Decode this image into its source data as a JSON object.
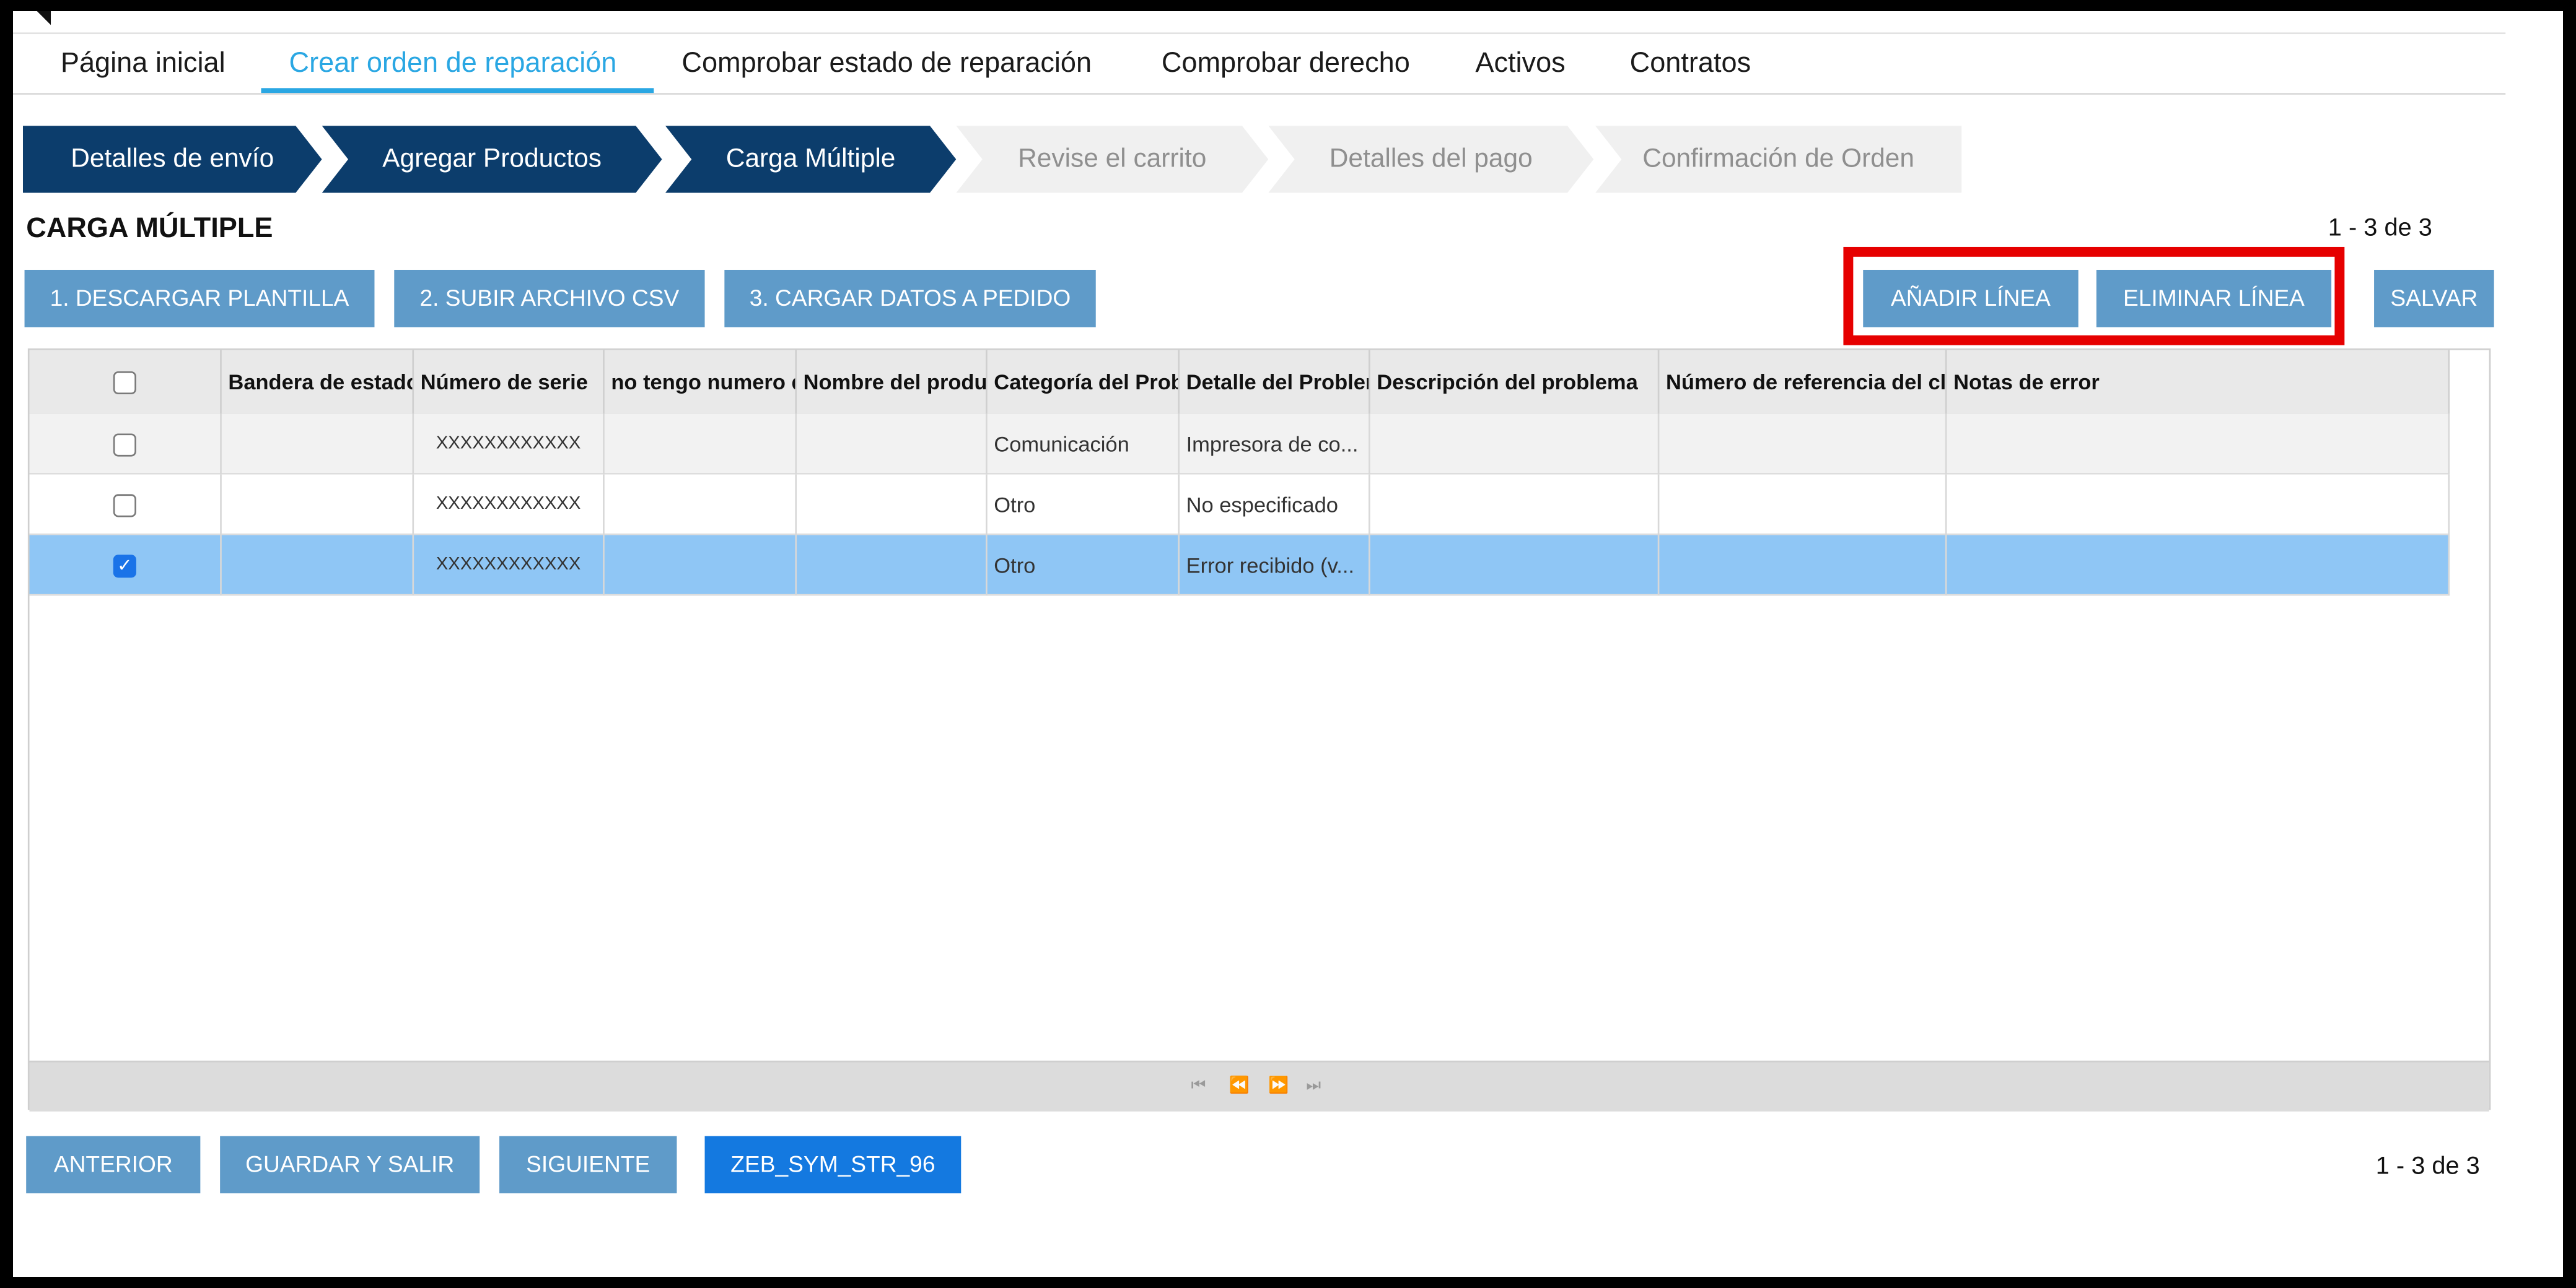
{
  "nav": {
    "items": [
      {
        "label": "Página inicial"
      },
      {
        "label": "Crear orden de reparación"
      },
      {
        "label": "Comprobar estado de reparación"
      },
      {
        "label": "Comprobar derecho"
      },
      {
        "label": "Activos"
      },
      {
        "label": "Contratos"
      }
    ],
    "active_index": 1
  },
  "stepper": {
    "steps": [
      {
        "label": "Detalles de envío",
        "state": "done"
      },
      {
        "label": "Agregar Productos",
        "state": "done"
      },
      {
        "label": "Carga Múltiple",
        "state": "current"
      },
      {
        "label": "Revise el carrito",
        "state": "todo"
      },
      {
        "label": "Detalles del pago",
        "state": "todo"
      },
      {
        "label": "Confirmación de Orden",
        "state": "todo"
      }
    ]
  },
  "section": {
    "title": "CARGA MÚLTIPLE",
    "count_top": "1 - 3 de 3",
    "count_bottom": "1 - 3 de 3"
  },
  "toolbar": {
    "download_template": "1. DESCARGAR PLANTILLA",
    "upload_csv": "2. SUBIR ARCHIVO CSV",
    "load_to_order": "3. CARGAR DATOS A PEDIDO",
    "add_line": "AÑADIR LÍNEA",
    "delete_line": "ELIMINAR LÍNEA",
    "save": "SALVAR"
  },
  "grid": {
    "columns": [
      "",
      "Bandera de estado",
      "Número de serie",
      "no tengo numero de serie",
      "Nombre del producto",
      "Categoría del Problema",
      "Detalle del Problema",
      "Descripción del problema",
      "Número de referencia del cliente",
      "Notas de error"
    ],
    "rows": [
      {
        "checked": false,
        "cells": [
          "",
          "XXXXXXXXXXXX",
          "",
          "",
          "Comunicación",
          "Impresora de co...",
          "",
          "",
          ""
        ]
      },
      {
        "checked": false,
        "cells": [
          "",
          "XXXXXXXXXXXX",
          "",
          "",
          "Otro",
          "No especificado",
          "",
          "",
          ""
        ]
      },
      {
        "checked": true,
        "cells": [
          "",
          "XXXXXXXXXXXX",
          "",
          "",
          "Otro",
          "Error recibido (v...",
          "",
          "",
          ""
        ]
      }
    ],
    "pager_icons": [
      "first-page-icon",
      "prev-page-icon",
      "next-page-icon",
      "last-page-icon"
    ]
  },
  "footer": {
    "previous": "ANTERIOR",
    "save_and_exit": "GUARDAR Y SALIR",
    "next": "SIGUIENTE",
    "code_button": "ZEB_SYM_STR_96"
  },
  "colors": {
    "accent": "#2aa7e3",
    "step_done": "#0c3d6c",
    "button": "#5f9bc9",
    "primary_button": "#1479e0",
    "selected_row": "#8fc6f5",
    "highlight": "#e60000"
  }
}
